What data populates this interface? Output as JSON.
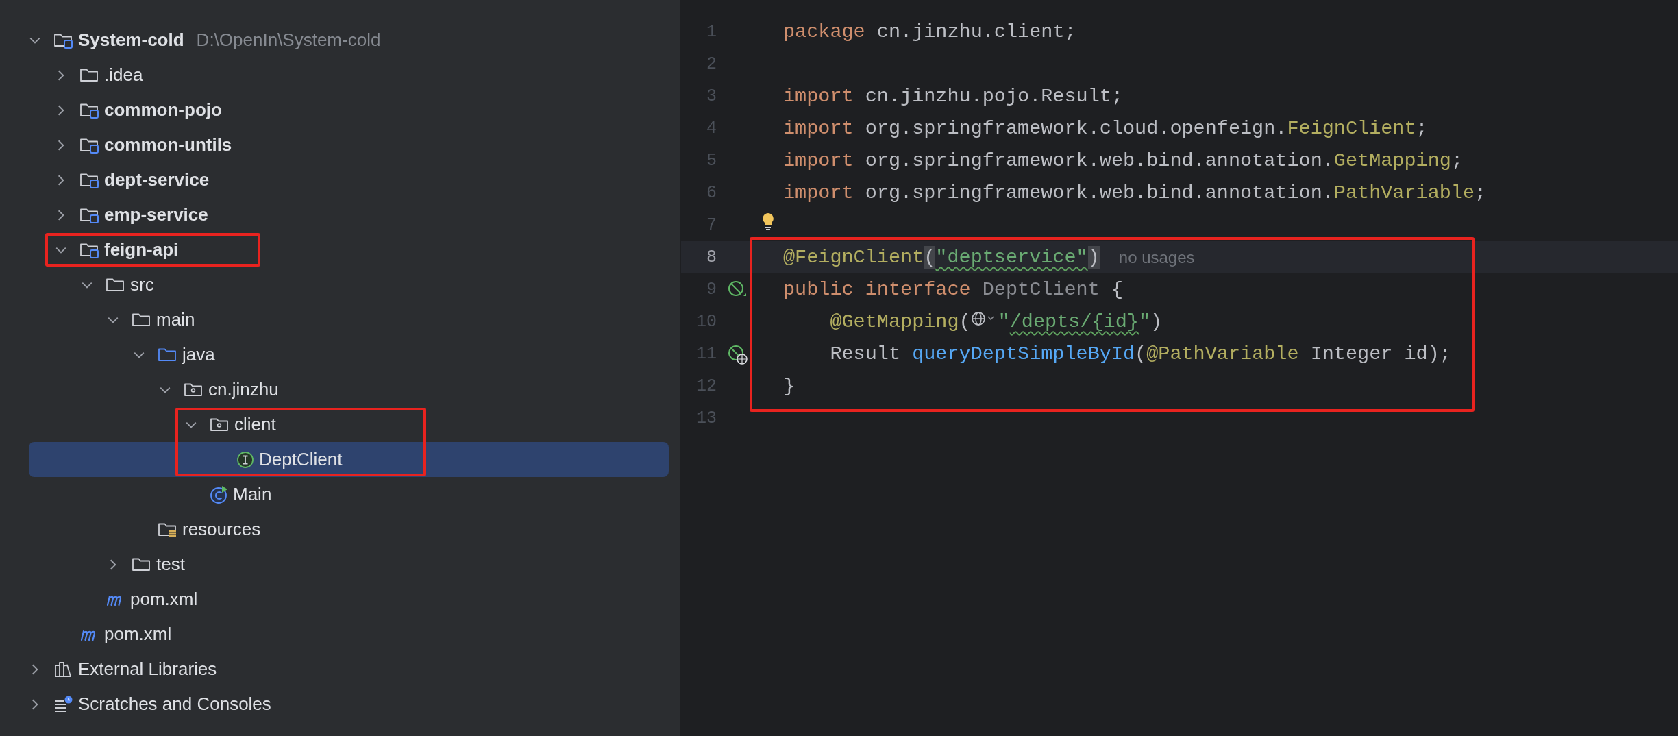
{
  "project_tree": {
    "items": [
      {
        "kind": "module",
        "label": "System-cold",
        "hint": "D:\\OpenIn\\System-cold",
        "expanded": true,
        "selected": false,
        "children": [
          {
            "kind": "folder",
            "label": ".idea",
            "expanded": false,
            "selected": false
          },
          {
            "kind": "module",
            "label": "common-pojo",
            "expanded": false,
            "selected": false
          },
          {
            "kind": "module",
            "label": "common-untils",
            "expanded": false,
            "selected": false
          },
          {
            "kind": "module",
            "label": "dept-service",
            "expanded": false,
            "selected": false
          },
          {
            "kind": "module",
            "label": "emp-service",
            "expanded": false,
            "selected": false
          },
          {
            "kind": "module",
            "label": "feign-api",
            "expanded": true,
            "selected": false,
            "outlined": true,
            "children": [
              {
                "kind": "folder",
                "label": "src",
                "expanded": true,
                "selected": false,
                "children": [
                  {
                    "kind": "folder",
                    "label": "main",
                    "expanded": true,
                    "selected": false,
                    "children": [
                      {
                        "kind": "source",
                        "label": "java",
                        "expanded": true,
                        "selected": false,
                        "children": [
                          {
                            "kind": "package",
                            "label": "cn.jinzhu",
                            "expanded": true,
                            "selected": false,
                            "children": [
                              {
                                "kind": "package",
                                "label": "client",
                                "expanded": true,
                                "selected": false,
                                "outlined": true,
                                "children": [
                                  {
                                    "kind": "interface",
                                    "label": "DeptClient",
                                    "selected": true,
                                    "outlined": true
                                  }
                                ]
                              },
                              {
                                "kind": "class",
                                "label": "Main",
                                "selected": false
                              }
                            ]
                          }
                        ]
                      },
                      {
                        "kind": "resources",
                        "label": "resources",
                        "selected": false
                      }
                    ]
                  },
                  {
                    "kind": "folder",
                    "label": "test",
                    "expanded": false,
                    "selected": false
                  }
                ]
              },
              {
                "kind": "maven",
                "label": "pom.xml",
                "selected": false
              }
            ]
          },
          {
            "kind": "maven",
            "label": "pom.xml",
            "selected": false
          }
        ]
      },
      {
        "kind": "libraries",
        "label": "External Libraries",
        "expanded": false,
        "selected": false
      },
      {
        "kind": "scratches",
        "label": "Scratches and Consoles",
        "expanded": false,
        "selected": false
      }
    ]
  },
  "editor": {
    "lines": [
      {
        "number": "1",
        "tokens": [
          {
            "kind": "keyword",
            "text": "package"
          },
          {
            "kind": "plain",
            "text": " cn.jinzhu.client;"
          }
        ]
      },
      {
        "number": "2"
      },
      {
        "number": "3",
        "tokens": [
          {
            "kind": "keyword",
            "text": "import"
          },
          {
            "kind": "plain",
            "text": " cn.jinzhu.pojo.Result;"
          }
        ]
      },
      {
        "number": "4",
        "tokens": [
          {
            "kind": "keyword",
            "text": "import"
          },
          {
            "kind": "plain",
            "text": " org.springframework.cloud.openfeign."
          },
          {
            "kind": "annotation",
            "text": "FeignClient"
          },
          {
            "kind": "plain",
            "text": ";"
          }
        ]
      },
      {
        "number": "5",
        "tokens": [
          {
            "kind": "keyword",
            "text": "import"
          },
          {
            "kind": "plain",
            "text": " org.springframework.web.bind.annotation."
          },
          {
            "kind": "annotation",
            "text": "GetMapping"
          },
          {
            "kind": "plain",
            "text": ";"
          }
        ]
      },
      {
        "number": "6",
        "tokens": [
          {
            "kind": "keyword",
            "text": "import"
          },
          {
            "kind": "plain",
            "text": " org.springframework.web.bind.annotation."
          },
          {
            "kind": "annotation",
            "text": "PathVariable"
          },
          {
            "kind": "plain",
            "text": ";"
          }
        ]
      },
      {
        "number": "7",
        "bulb": true
      },
      {
        "number": "8",
        "current": true,
        "marked": true,
        "inlay": "no usages",
        "tokens": [
          {
            "kind": "annotation",
            "text": "@FeignClient"
          },
          {
            "kind": "paren",
            "text": "("
          },
          {
            "kind": "string",
            "text": "\"deptservice\"",
            "squiggly": true
          },
          {
            "kind": "paren",
            "text": ")"
          }
        ]
      },
      {
        "number": "9",
        "marked": true,
        "implemented": true,
        "tokens": [
          {
            "kind": "keyword",
            "text": "public interface"
          },
          {
            "kind": "declared",
            "text": " DeptClient"
          },
          {
            "kind": "plain",
            "text": " {"
          }
        ]
      },
      {
        "number": "10",
        "marked": true,
        "tokens": [
          {
            "kind": "annotation",
            "text": "    @GetMapping"
          },
          {
            "kind": "plain",
            "text": "("
          },
          {
            "kind": "globe"
          },
          {
            "kind": "string",
            "text": "\""
          },
          {
            "kind": "string",
            "text": "/depts/{id}",
            "squiggly": true
          },
          {
            "kind": "string",
            "text": "\""
          },
          {
            "kind": "plain",
            "text": ")"
          }
        ]
      },
      {
        "number": "11",
        "marked": true,
        "implemented": true,
        "endpoint": true,
        "tokens": [
          {
            "kind": "plain",
            "text": "    Result "
          },
          {
            "kind": "method",
            "text": "queryDeptSimpleById"
          },
          {
            "kind": "plain",
            "text": "("
          },
          {
            "kind": "annotation",
            "text": "@PathVariable"
          },
          {
            "kind": "plain",
            "text": " Integer id);"
          }
        ]
      },
      {
        "number": "12",
        "marked": true,
        "tokens": [
          {
            "kind": "plain",
            "text": "}"
          }
        ]
      },
      {
        "number": "13"
      }
    ]
  }
}
